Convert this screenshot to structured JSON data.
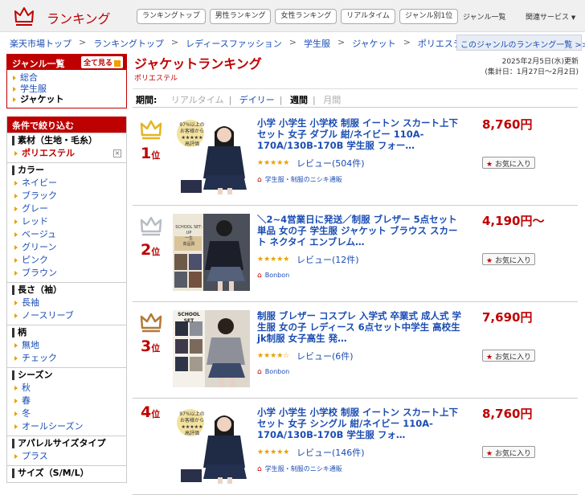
{
  "header": {
    "site_title": "ランキング",
    "nav": [
      "ランキングトップ",
      "男性ランキング",
      "女性ランキング",
      "リアルタイム",
      "ジャンル別1位"
    ],
    "genre_list": "ジャンル一覧",
    "related": "関連サービス",
    "related_icon": "triangle-down-icon"
  },
  "breadcrumb": {
    "items": [
      "楽天市場トップ",
      "ランキングトップ",
      "レディースファッション",
      "学生服",
      "ジャケット",
      "ポリエステル"
    ],
    "separator": ">",
    "other_ranking": "このジャンルのランキング一覧 >>"
  },
  "sidebar": {
    "genre_head": "ジャンル一覧",
    "all_see": "全て見る",
    "genres": [
      "総合",
      "学生服",
      "ジャケット"
    ],
    "filter_head": "条件で絞り込む",
    "groups": [
      {
        "title": "素材（生地・毛糸）",
        "options": [
          "ポリエステル"
        ],
        "selected": "ポリエステル"
      },
      {
        "title": "カラー",
        "options": [
          "ネイビー",
          "ブラック",
          "グレー",
          "レッド",
          "ベージュ",
          "グリーン",
          "ピンク",
          "ブラウン"
        ]
      },
      {
        "title": "長さ（袖）",
        "options": [
          "長袖",
          "ノースリーブ"
        ]
      },
      {
        "title": "柄",
        "options": [
          "無地",
          "チェック"
        ]
      },
      {
        "title": "シーズン",
        "options": [
          "秋",
          "春",
          "冬",
          "オールシーズン"
        ]
      },
      {
        "title": "アパレルサイズタイプ",
        "options": [
          "プラス"
        ]
      },
      {
        "title": "サイズ（S/M/L）",
        "options": []
      }
    ]
  },
  "main": {
    "title": "ジャケットランキング",
    "subtitle": "ポリエステル",
    "updated": "2025年2月5日(水)更新",
    "period_range": "(集計日：1月27日～2月2日)",
    "period_label": "期間:",
    "periods": [
      "リアルタイム",
      "デイリー",
      "週間",
      "月間"
    ],
    "current_period": "週間",
    "fav_label": "お気に入り",
    "items": [
      {
        "rank": "1",
        "rank_suffix": "位",
        "crown": "gold",
        "title": "小学 小学生 小学校 制服 イートン スカート上下セット 女子 ダブル 紺/ネイビー 110A-170A/130B-170B 学生服 フォー…",
        "price": "8,760円",
        "stars": "★★★★★",
        "review": "レビュー(504件)",
        "shop": "学生服・制服のニシキ通販",
        "img_texts": [
          "97%以上の",
          "お客様から",
          "★★★★★",
          "高評価"
        ]
      },
      {
        "rank": "2",
        "rank_suffix": "位",
        "crown": "silver",
        "title": "＼2~4営業日に発送／制服 ブレザー 5点セット 単品 女の子 学生服 ジャケット ブラウス スカート ネクタイ エンブレム…",
        "price": "4,190円～",
        "stars": "★★★★★",
        "review": "レビュー(12件)",
        "shop": "Bonbon",
        "img_texts": [
          "SCHOOL SET-UP",
          "一生",
          "高品質"
        ]
      },
      {
        "rank": "3",
        "rank_suffix": "位",
        "crown": "bronze",
        "title": "制服 ブレザー コスプレ 入学式 卒業式 成人式 学生服 女の子 レディース 6点セット中学生 高校生 jk制服 女子高生 発…",
        "price": "7,690円",
        "stars": "★★★★☆",
        "review": "レビュー(6件)",
        "shop": "Bonbon",
        "img_texts": [
          "SCHOOL SET"
        ]
      },
      {
        "rank": "4",
        "rank_suffix": "位",
        "crown": "none",
        "title": "小学 小学生 小学校 制服 イートン スカート上下セット 女子 シングル 紺/ネイビー 110A-170A/130B-170B 学生服 フォ…",
        "price": "8,760円",
        "stars": "★★★★★",
        "review": "レビュー(146件)",
        "shop": "学生服・制服のニシキ通販",
        "img_texts": [
          "97%以上の",
          "お客様から",
          "★★★★★",
          "高評価"
        ]
      }
    ]
  },
  "colors": {
    "brand_red": "#bf0000",
    "link_blue": "#1a4db3",
    "gold": "#e6b422",
    "silver": "#b7bcc4",
    "bronze": "#b5793a"
  }
}
